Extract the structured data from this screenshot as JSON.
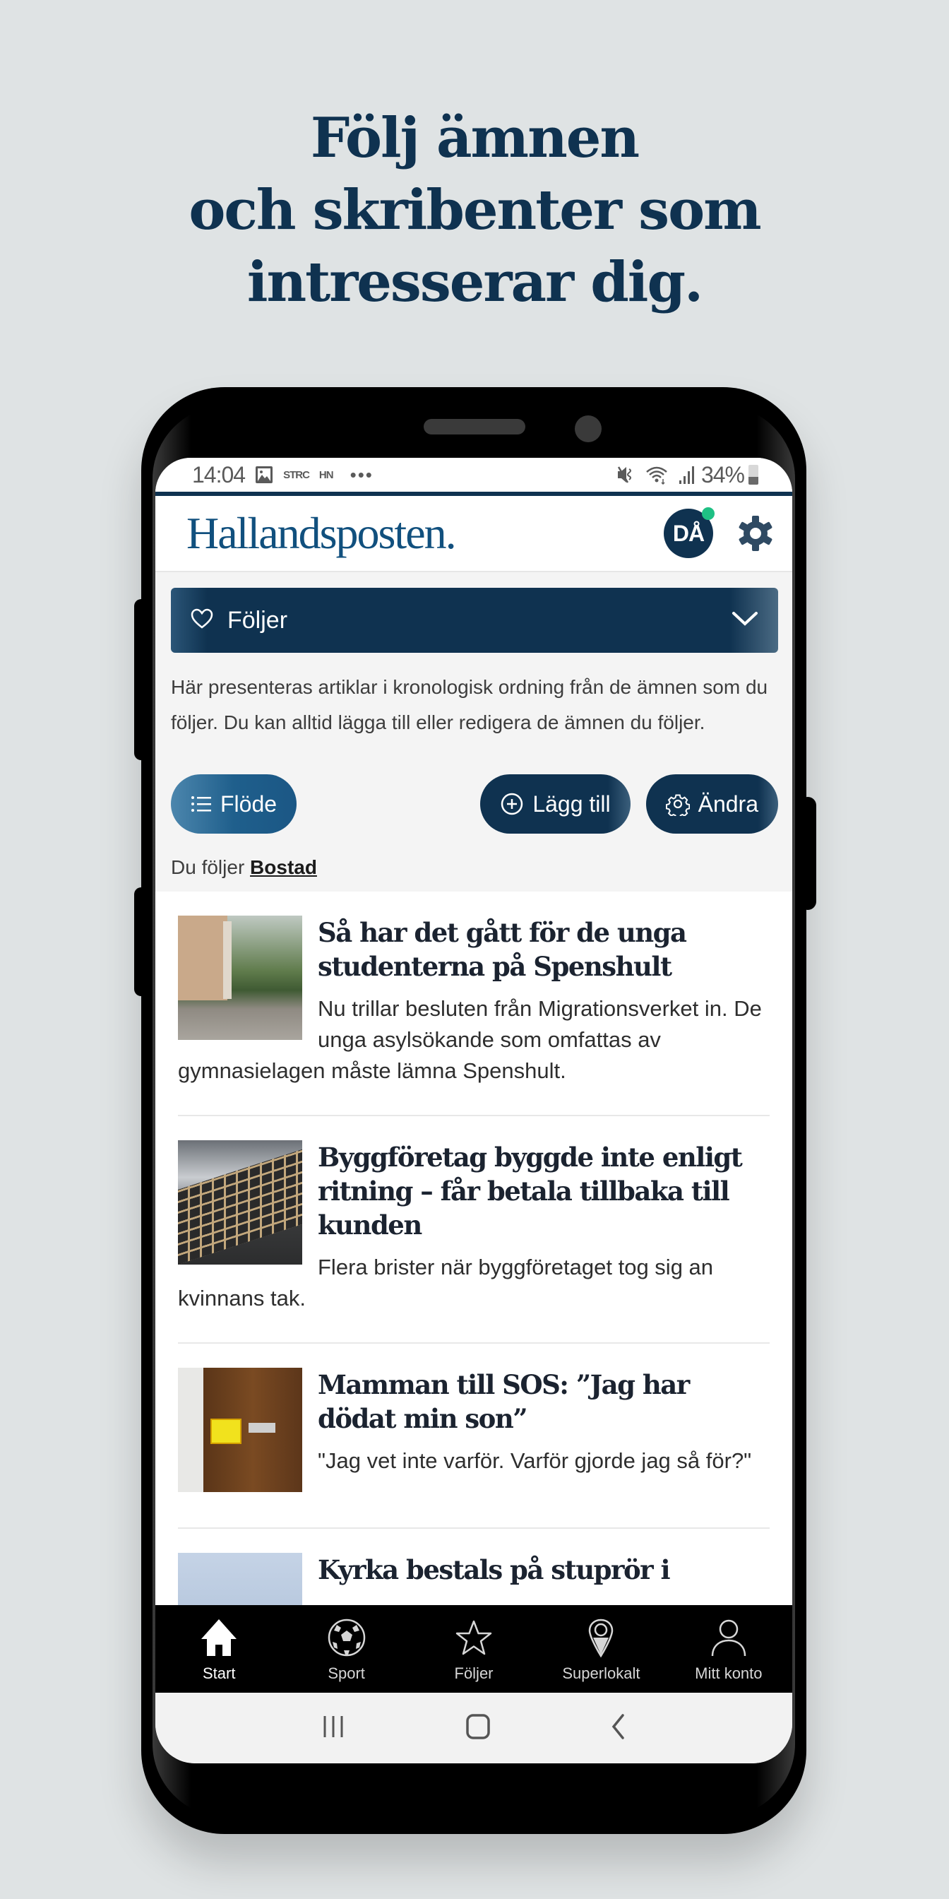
{
  "promo": {
    "headline_lines": [
      "Följ ämnen",
      "och skribenter som",
      "intresserar dig."
    ]
  },
  "statusbar": {
    "time": "14:04",
    "left_icons": [
      "gallery-icon",
      "STRC",
      "HN",
      "more-dots-icon"
    ],
    "label_strc": "STRC",
    "label_hn": "HN",
    "dots": "•••",
    "right_icons": [
      "mute-vibrate-icon",
      "wifi-icon",
      "signal-icon",
      "battery-icon"
    ],
    "battery_percent": "34%"
  },
  "app": {
    "logo": "Hallandsposten.",
    "avatar_initials": "DÅ",
    "avatar_notification": true,
    "colors": {
      "brand": "#0f3250",
      "logo": "#11507e",
      "notification": "#1fc084"
    }
  },
  "section": {
    "dropdown_label": "Följer",
    "description": "Här presenteras artiklar i kronologisk ordning från de ämnen som du följer. Du kan alltid lägga till eller redigera de ämnen du följer.",
    "buttons": {
      "flode": "Flöde",
      "add": "Lägg till",
      "edit": "Ändra"
    },
    "following_prefix": "Du följer",
    "following_topic": "Bostad"
  },
  "articles": [
    {
      "title": "Så har det gått för de unga studenterna på Spenshult",
      "lead": "Nu trillar besluten från Migrationsverket in. De unga asylsökande som omfattas av gymnasielagen måste lämna Spenshult."
    },
    {
      "title": "Byggföretag byggde inte enligt ritning – får betala tillbaka till kunden",
      "lead": "Flera brister när byggföretaget tog sig an kvinnans tak."
    },
    {
      "title": "Mamman till SOS: ”Jag har dödat min son”",
      "lead": "\"Jag vet inte varför. Varför gjorde jag så för?\""
    },
    {
      "title": "Kyrka bestals på stuprör i",
      "lead": ""
    }
  ],
  "bottom_nav": [
    {
      "label": "Start",
      "icon": "home-icon",
      "active": true
    },
    {
      "label": "Sport",
      "icon": "soccer-ball-icon",
      "active": false
    },
    {
      "label": "Följer",
      "icon": "star-icon",
      "active": false
    },
    {
      "label": "Superlokalt",
      "icon": "location-pin-icon",
      "active": false
    },
    {
      "label": "Mitt konto",
      "icon": "user-icon",
      "active": false
    }
  ],
  "system_nav": [
    "recent-apps-icon",
    "home-button-icon",
    "back-icon"
  ]
}
